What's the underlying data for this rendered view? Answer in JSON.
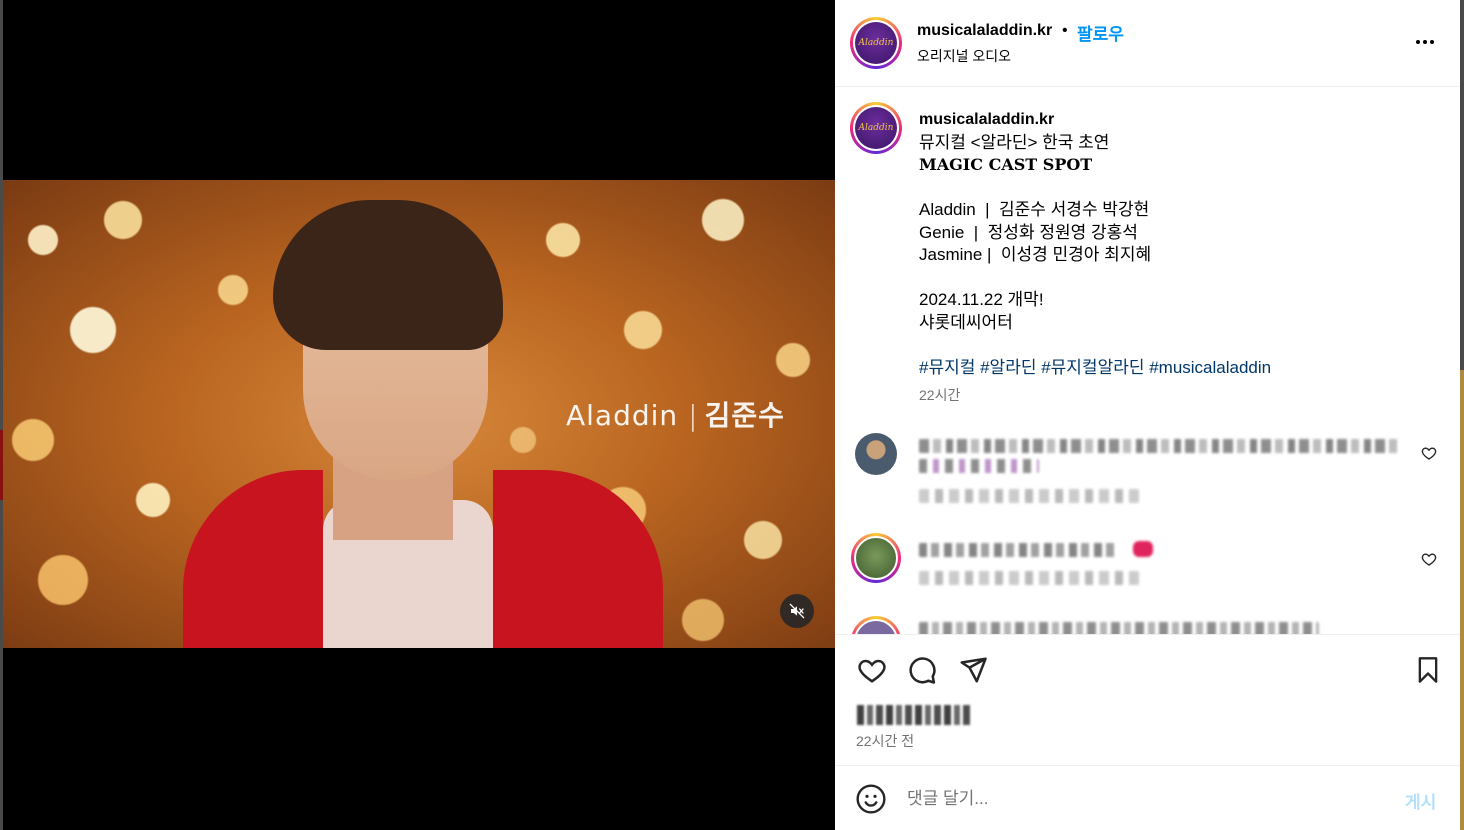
{
  "post": {
    "username": "musicalaladdin.kr",
    "separator": "•",
    "follow_label": "팔로우",
    "audio_label": "오리지널 오디오",
    "avatar_logo_text": "Aladdin"
  },
  "video": {
    "overlay_role": "Aladdin",
    "overlay_separator": "|",
    "overlay_name": "김준수",
    "mute_icon": "muted-speaker-icon"
  },
  "caption": {
    "username": "musicalaladdin.kr",
    "line1": "뮤지컬 <알라딘> 한국 초연",
    "title": "MAGIC CAST SPOT",
    "cast": [
      "Aladdin  |  김준수 서경수 박강현",
      "Genie  |  정성화 정원영 강홍석",
      "Jasmine |  이성경 민경아 최지혜"
    ],
    "date_line": "2024.11.22 개막!",
    "venue_line": "샤롯데씨어터",
    "hashtags": "#뮤지컬 #알라딘 #뮤지컬알라딘 #musicalaladdin",
    "time": "22시간"
  },
  "actions": {
    "like_icon": "heart-icon",
    "comment_icon": "comment-icon",
    "share_icon": "paper-plane-icon",
    "save_icon": "bookmark-icon",
    "post_time": "22시간 전"
  },
  "add_comment": {
    "emoji_icon": "smiley-icon",
    "placeholder": "댓글 달기...",
    "post_label": "게시"
  },
  "colors": {
    "accent": "#0095f6",
    "link": "#00376b",
    "muted": "#737373",
    "post_disabled": "#b2dffc"
  }
}
